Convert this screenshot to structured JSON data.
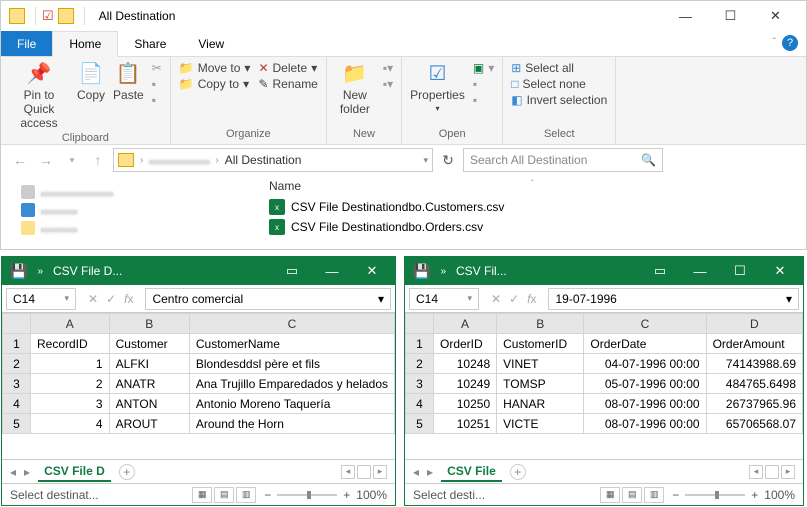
{
  "explorer": {
    "title": "All Destination",
    "tabs": {
      "file": "File",
      "home": "Home",
      "share": "Share",
      "view": "View"
    },
    "ribbon": {
      "pin": "Pin to Quick access",
      "copy": "Copy",
      "paste": "Paste",
      "clipboard": "Clipboard",
      "moveto": "Move to",
      "copyto": "Copy to",
      "delete": "Delete",
      "rename": "Rename",
      "organize": "Organize",
      "newfolder": "New folder",
      "new": "New",
      "properties": "Properties",
      "open": "Open",
      "selectall": "Select all",
      "selectnone": "Select none",
      "invert": "Invert selection",
      "select": "Select"
    },
    "breadcrumb": "All Destination",
    "search_placeholder": "Search All Destination",
    "columns": {
      "name": "Name"
    },
    "files": [
      "CSV File Destinationdbo.Customers.csv",
      "CSV File Destinationdbo.Orders.csv"
    ]
  },
  "excel_left": {
    "title": "CSV File D...",
    "cellref": "C14",
    "formula_value": "Centro comercial",
    "cols": [
      "A",
      "B",
      "C"
    ],
    "headers": [
      "RecordID",
      "Customer",
      "CustomerName"
    ],
    "rows": [
      [
        "1",
        "ALFKI",
        "Blondesddsl père et fils"
      ],
      [
        "2",
        "ANATR",
        "Ana Trujillo Emparedados y helados"
      ],
      [
        "3",
        "ANTON",
        "Antonio Moreno Taquería"
      ],
      [
        "4",
        "AROUT",
        "Around the Horn"
      ]
    ],
    "sheet": "CSV File D",
    "status": "Select destinat...",
    "zoom": "100%"
  },
  "excel_right": {
    "title": "CSV Fil...",
    "cellref": "C14",
    "formula_value": "19-07-1996",
    "cols": [
      "A",
      "B",
      "C",
      "D"
    ],
    "headers": [
      "OrderID",
      "CustomerID",
      "OrderDate",
      "OrderAmount"
    ],
    "rows": [
      [
        "10248",
        "VINET",
        "04-07-1996 00:00",
        "74143988.69"
      ],
      [
        "10249",
        "TOMSP",
        "05-07-1996 00:00",
        "484765.6498"
      ],
      [
        "10250",
        "HANAR",
        "08-07-1996 00:00",
        "26737965.96"
      ],
      [
        "10251",
        "VICTE",
        "08-07-1996 00:00",
        "65706568.07"
      ]
    ],
    "sheet": "CSV File",
    "status": "Select desti...",
    "zoom": "100%"
  }
}
